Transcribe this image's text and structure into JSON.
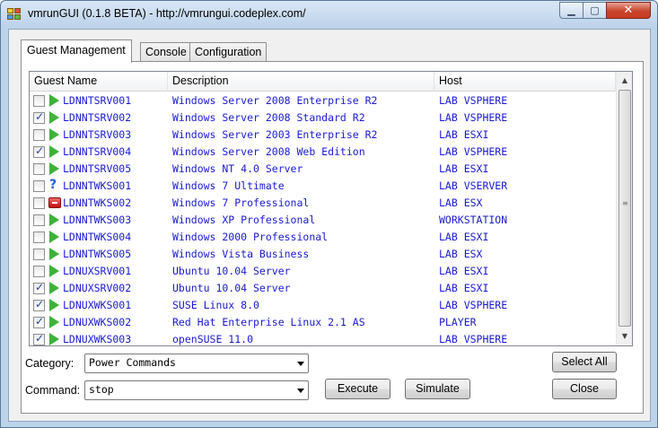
{
  "window": {
    "title": "vmrunGUI (0.1.8 BETA) - http://vmrungui.codeplex.com/"
  },
  "tabs": [
    "Guest Management",
    "Console",
    "Configuration"
  ],
  "columns": [
    "Guest Name",
    "Description",
    "Host"
  ],
  "guests": [
    {
      "checked": false,
      "status": "running",
      "name": "LDNNTSRV001",
      "desc": "Windows Server 2008 Enterprise R2",
      "host": "LAB VSPHERE"
    },
    {
      "checked": true,
      "status": "running",
      "name": "LDNNTSRV002",
      "desc": "Windows Server 2008 Standard R2",
      "host": "LAB VSPHERE"
    },
    {
      "checked": false,
      "status": "running",
      "name": "LDNNTSRV003",
      "desc": "Windows Server 2003 Enterprise R2",
      "host": "LAB ESXI"
    },
    {
      "checked": true,
      "status": "running",
      "name": "LDNNTSRV004",
      "desc": "Windows Server 2008 Web Edition",
      "host": "LAB VSPHERE"
    },
    {
      "checked": false,
      "status": "running",
      "name": "LDNNTSRV005",
      "desc": "Windows NT 4.0 Server",
      "host": "LAB ESXI"
    },
    {
      "checked": false,
      "status": "unknown",
      "name": "LDNNTWKS001",
      "desc": "Windows 7 Ultimate",
      "host": "LAB VSERVER"
    },
    {
      "checked": false,
      "status": "stopped",
      "name": "LDNNTWKS002",
      "desc": "Windows 7 Professional",
      "host": "LAB ESX"
    },
    {
      "checked": false,
      "status": "running",
      "name": "LDNNTWKS003",
      "desc": "Windows XP Professional",
      "host": "WORKSTATION"
    },
    {
      "checked": false,
      "status": "running",
      "name": "LDNNTWKS004",
      "desc": "Windows 2000 Professional",
      "host": "LAB ESXI"
    },
    {
      "checked": false,
      "status": "running",
      "name": "LDNNTWKS005",
      "desc": "Windows Vista Business",
      "host": "LAB ESX"
    },
    {
      "checked": false,
      "status": "running",
      "name": "LDNUXSRV001",
      "desc": "Ubuntu 10.04 Server",
      "host": "LAB ESXI"
    },
    {
      "checked": true,
      "status": "running",
      "name": "LDNUXSRV002",
      "desc": "Ubuntu 10.04 Server",
      "host": "LAB ESXI"
    },
    {
      "checked": true,
      "status": "running",
      "name": "LDNUXWKS001",
      "desc": "SUSE Linux 8.0",
      "host": "LAB VSPHERE"
    },
    {
      "checked": true,
      "status": "running",
      "name": "LDNUXWKS002",
      "desc": "Red Hat Enterprise Linux 2.1 AS",
      "host": "PLAYER"
    },
    {
      "checked": true,
      "status": "running",
      "name": "LDNUXWKS003",
      "desc": "openSUSE 11.0",
      "host": "LAB VSPHERE"
    }
  ],
  "controls": {
    "category_label": "Category:",
    "category_value": "Power Commands",
    "command_label": "Command:",
    "command_value": "stop",
    "execute": "Execute",
    "simulate": "Simulate",
    "select_all": "Select All",
    "close": "Close"
  },
  "icons": {
    "running": "play-icon",
    "stopped": "stop-icon",
    "unknown": "question-icon"
  }
}
